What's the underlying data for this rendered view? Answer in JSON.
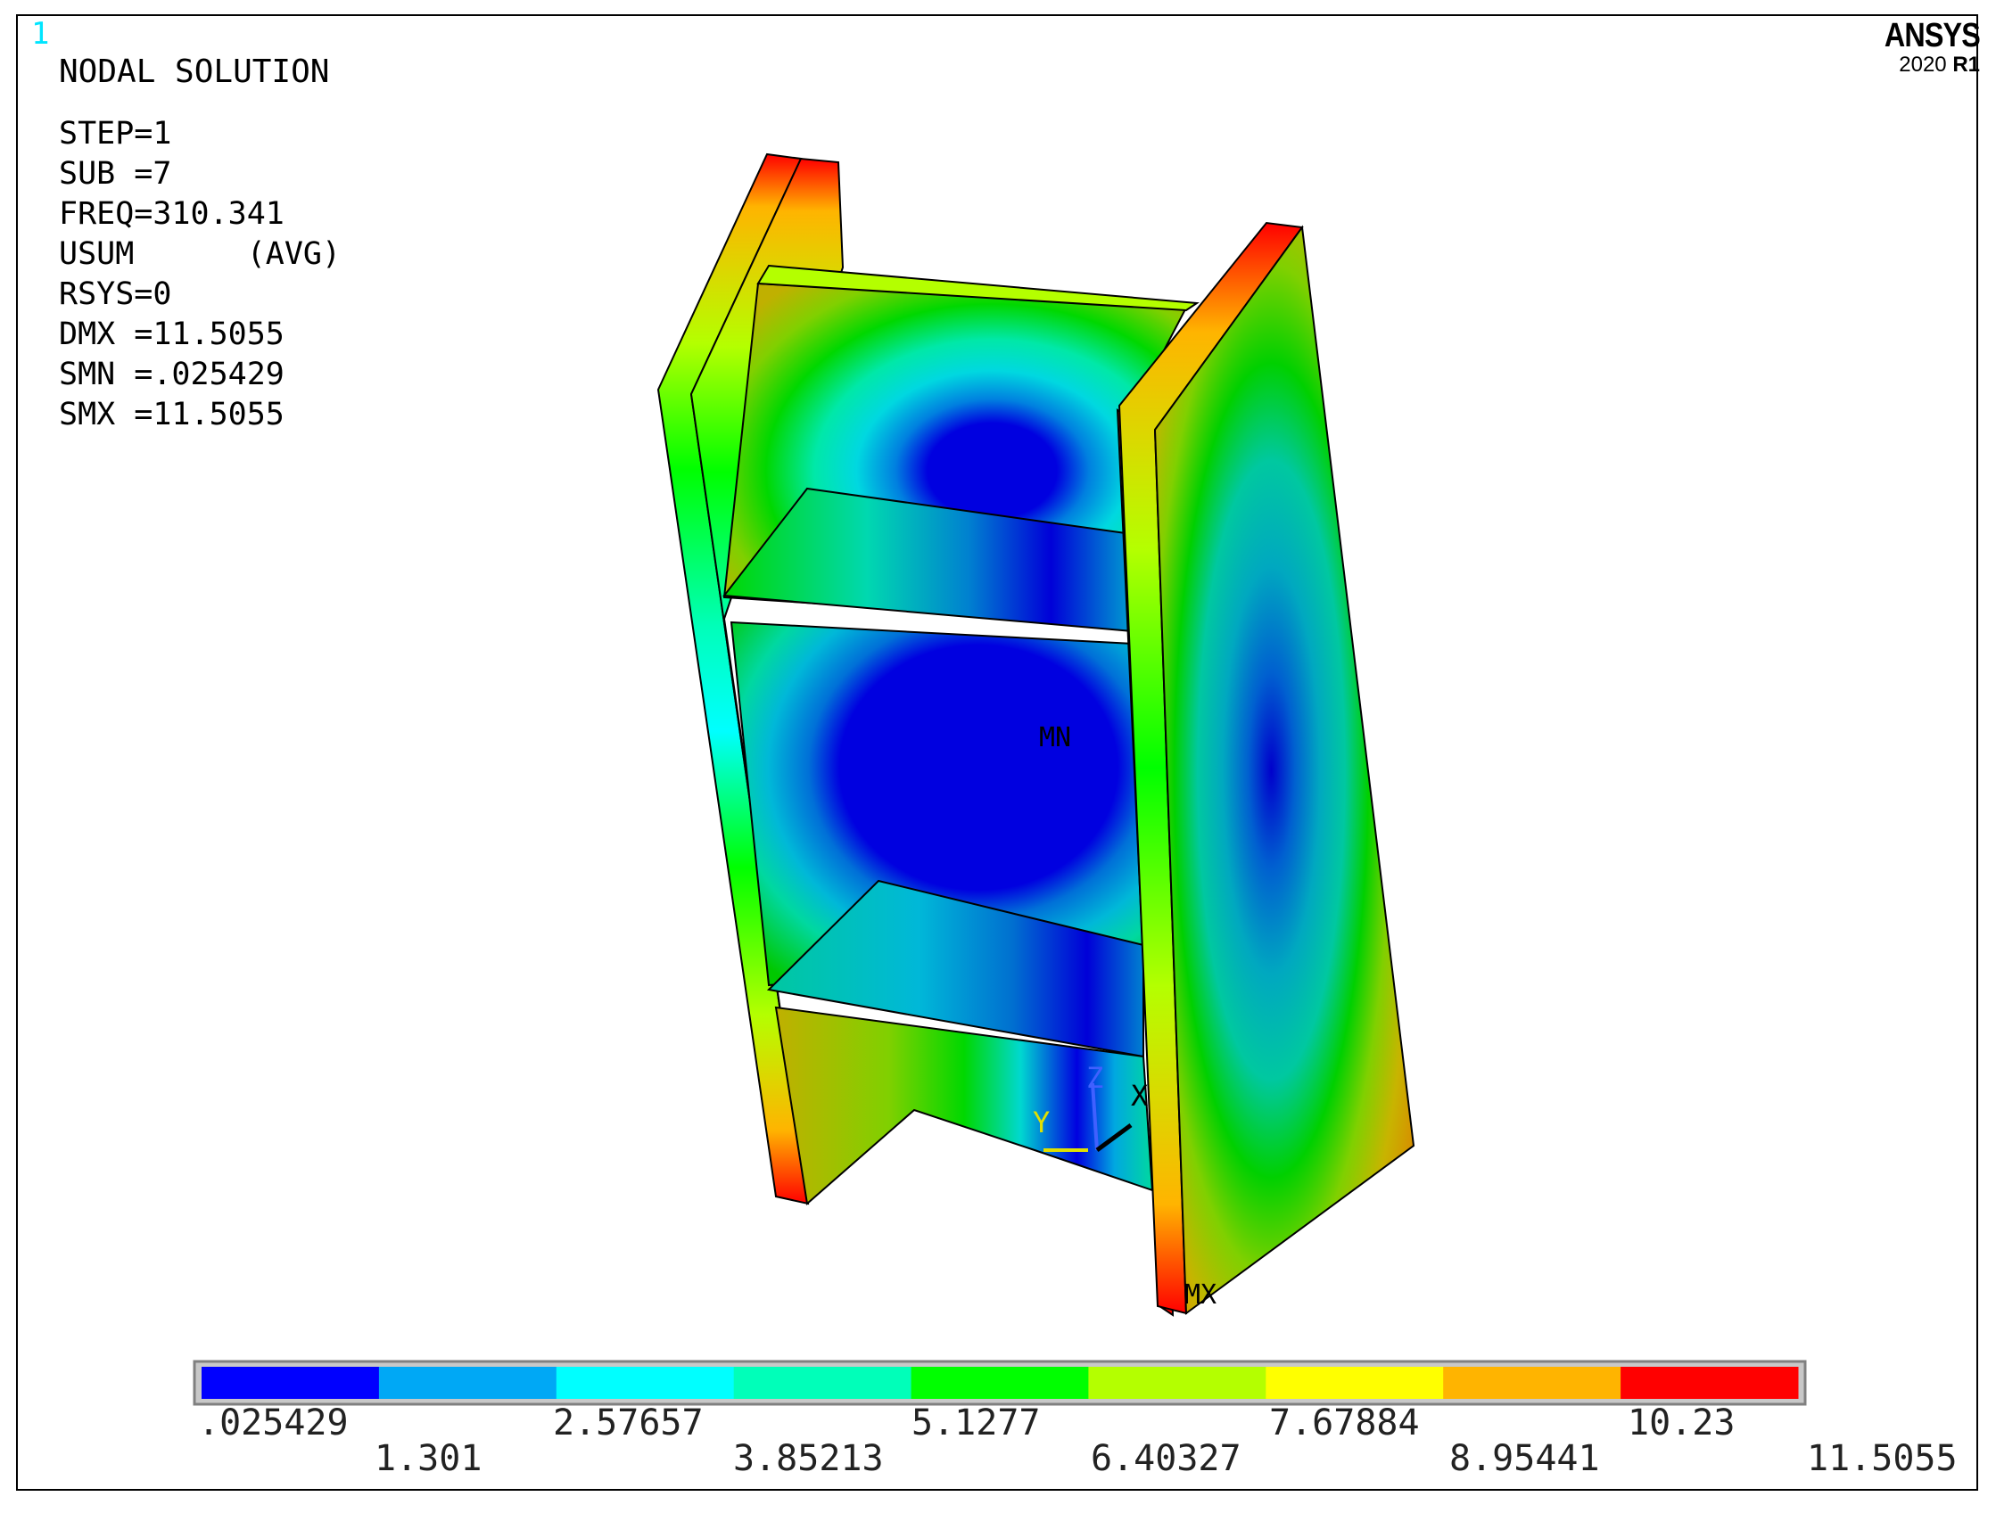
{
  "viewport": {
    "window_number": "1",
    "result_title": "NODAL SOLUTION",
    "result_info": [
      "STEP=1",
      "SUB =7",
      "FREQ=310.341",
      "USUM      (AVG)",
      "RSYS=0",
      "DMX =11.5055",
      "SMN =.025429",
      "SMX =11.5055"
    ],
    "logo": {
      "brand": "ANSYS",
      "version_year": "2020",
      "version_release": "R1"
    }
  },
  "model": {
    "min_marker": "MN",
    "max_marker": "MX",
    "triad_labels": {
      "x": "X",
      "y": "Y",
      "z": "Z"
    }
  },
  "legend": {
    "bands": [
      {
        "color": "#0000ff",
        "from": 0.025429,
        "to": 1.301
      },
      {
        "color": "#00a8f5",
        "from": 1.301,
        "to": 2.57657
      },
      {
        "color": "#00ffff",
        "from": 2.57657,
        "to": 3.85213
      },
      {
        "color": "#00ffb9",
        "from": 3.85213,
        "to": 5.1277
      },
      {
        "color": "#00ff00",
        "from": 5.1277,
        "to": 6.40327
      },
      {
        "color": "#b4ff00",
        "from": 6.40327,
        "to": 7.67884
      },
      {
        "color": "#ffff00",
        "from": 7.67884,
        "to": 8.95441
      },
      {
        "color": "#ffb400",
        "from": 8.95441,
        "to": 10.23
      },
      {
        "color": "#ff0000",
        "from": 10.23,
        "to": 11.5055
      }
    ],
    "labels_top": [
      ".025429",
      "2.57657",
      "5.1277",
      "7.67884",
      "10.23"
    ],
    "labels_bottom": [
      "1.301",
      "3.85213",
      "6.40327",
      "8.95441",
      "11.5055"
    ]
  }
}
